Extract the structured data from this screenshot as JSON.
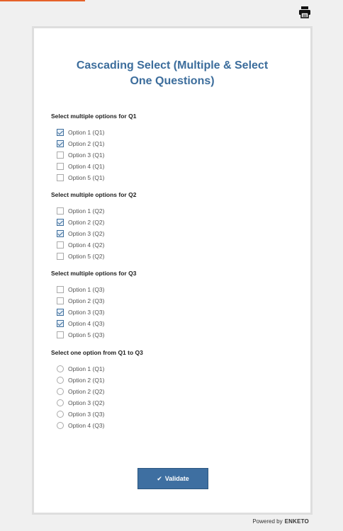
{
  "form": {
    "title": "Cascading Select (Multiple & Select One Questions)"
  },
  "questions": [
    {
      "label": "Select multiple options for Q1",
      "type": "checkbox",
      "options": [
        {
          "label": "Option 1 (Q1)",
          "checked": true
        },
        {
          "label": "Option 2 (Q1)",
          "checked": true
        },
        {
          "label": "Option 3 (Q1)",
          "checked": false
        },
        {
          "label": "Option 4 (Q1)",
          "checked": false
        },
        {
          "label": "Option 5 (Q1)",
          "checked": false
        }
      ]
    },
    {
      "label": "Select multiple options for Q2",
      "type": "checkbox",
      "options": [
        {
          "label": "Option 1 (Q2)",
          "checked": false
        },
        {
          "label": "Option 2 (Q2)",
          "checked": true
        },
        {
          "label": "Option 3 (Q2)",
          "checked": true
        },
        {
          "label": "Option 4 (Q2)",
          "checked": false
        },
        {
          "label": "Option 5 (Q2)",
          "checked": false
        }
      ]
    },
    {
      "label": "Select multiple options for Q3",
      "type": "checkbox",
      "options": [
        {
          "label": "Option 1 (Q3)",
          "checked": false
        },
        {
          "label": "Option 2 (Q3)",
          "checked": false
        },
        {
          "label": "Option 3 (Q3)",
          "checked": true
        },
        {
          "label": "Option 4 (Q3)",
          "checked": true
        },
        {
          "label": "Option 5 (Q3)",
          "checked": false
        }
      ]
    },
    {
      "label": "Select one option from Q1 to Q3",
      "type": "radio",
      "options": [
        {
          "label": "Option 1 (Q1)",
          "checked": false
        },
        {
          "label": "Option 2 (Q1)",
          "checked": false
        },
        {
          "label": "Option 2 (Q2)",
          "checked": false
        },
        {
          "label": "Option 3 (Q2)",
          "checked": false
        },
        {
          "label": "Option 3 (Q3)",
          "checked": false
        },
        {
          "label": "Option 4 (Q3)",
          "checked": false
        }
      ]
    }
  ],
  "actions": {
    "validate_label": "Validate"
  },
  "footer": {
    "powered_by": "Powered by",
    "brand": "ENKETO"
  },
  "colors": {
    "accent": "#3c6d9c",
    "top_accent": "#e6622a"
  },
  "icons": {
    "print": "printer-icon",
    "validate": "check-icon"
  }
}
